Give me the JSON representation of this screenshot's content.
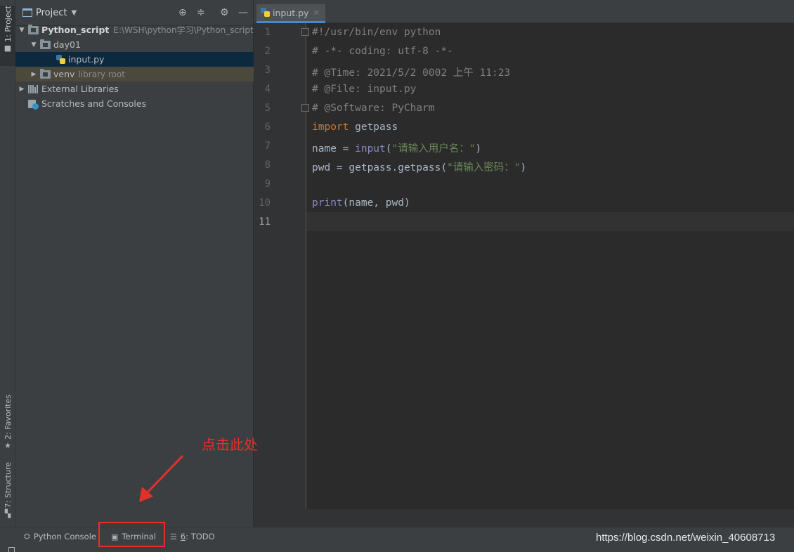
{
  "left_strip": {
    "project_tab": "1: Project",
    "favorites_tab": "2: Favorites",
    "structure_tab": "7: Structure"
  },
  "project_panel": {
    "title": "Project",
    "tree": {
      "root_name": "Python_script",
      "root_path": "E:\\WSH\\python学习\\Python_script",
      "day01": "day01",
      "input_file": "input.py",
      "venv": "venv",
      "venv_note": "library root",
      "external_libraries": "External Libraries",
      "scratches": "Scratches and Consoles"
    }
  },
  "editor": {
    "tab_label": "input.py",
    "line_numbers": [
      "1",
      "2",
      "3",
      "4",
      "5",
      "6",
      "7",
      "8",
      "9",
      "10",
      "11"
    ],
    "current_line": "11",
    "lines": {
      "l1": "#!/usr/bin/env python",
      "l2": "# -*- coding: utf-8 -*-",
      "l3": "# @Time: 2021/5/2 0002 上午 11:23",
      "l4": "# @File: input.py",
      "l5": "# @Software: PyCharm",
      "l6_kw": "import",
      "l6_rest": " getpass",
      "l7_a": "name = ",
      "l7_fn": "input",
      "l7_b": "(",
      "l7_str": "\"请输入用户名：\"",
      "l7_c": ")",
      "l8_a": "pwd = getpass.getpass(",
      "l8_str": "\"请输入密码：\"",
      "l8_b": ")",
      "l10_fn": "print",
      "l10_rest": "(name, pwd)"
    }
  },
  "bottom_bar": {
    "python_console": "Python Console",
    "terminal": "Terminal",
    "todo_num": "6",
    "todo_rest": ": TODO"
  },
  "annotation": {
    "text": "点击此处",
    "color": "#e5302a"
  },
  "watermark": "https://blog.csdn.net/weixin_40608713",
  "colors": {
    "editor_bg": "#2b2b2b",
    "panel_bg": "#3c3f41",
    "selection": "#0d293e",
    "keyword": "#cc7832",
    "builtin": "#8888c6",
    "string": "#6a8759",
    "comment": "#808080"
  }
}
